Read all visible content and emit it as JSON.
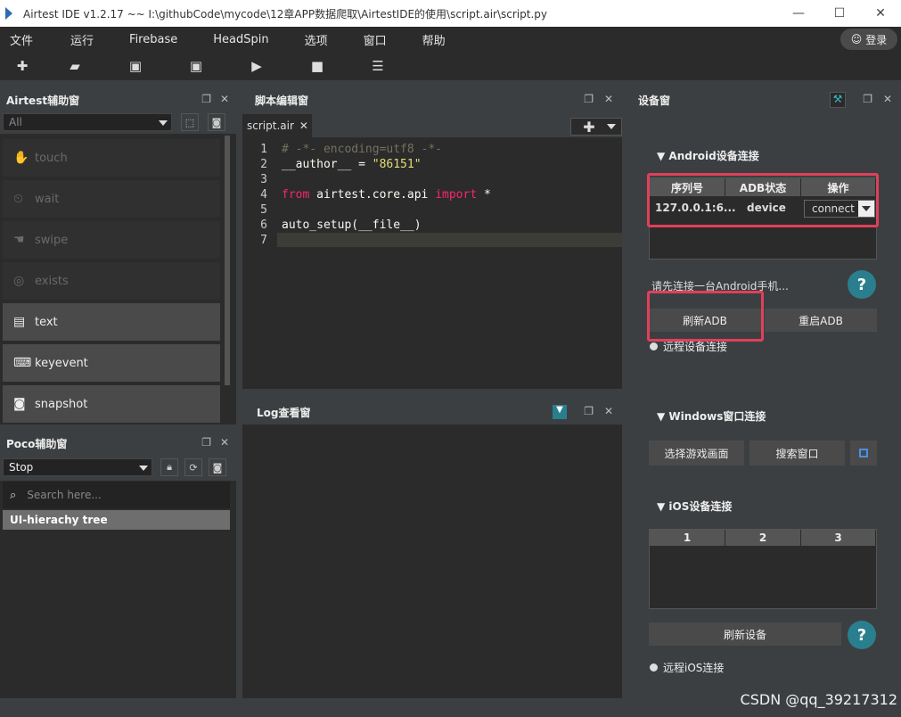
{
  "window": {
    "title": "Airtest IDE v1.2.17 ~~ I:\\githubCode\\mycode\\12章APP数据爬取\\AirtestIDE的使用\\script.air\\script.py",
    "minimize": "—",
    "maximize": "☐",
    "close": "✕"
  },
  "menu": {
    "items": [
      "文件",
      "运行",
      "Firebase",
      "HeadSpin",
      "选项",
      "窗口",
      "帮助"
    ],
    "login": "登录"
  },
  "toolbar": {
    "icons": [
      "new-icon",
      "open-icon",
      "save-icon",
      "save-as-icon",
      "run-icon",
      "stop-icon",
      "log-icon"
    ],
    "glyphs": [
      "✚",
      "▰",
      "▣",
      "▣",
      "▶",
      "■",
      "☰"
    ]
  },
  "airtest_panel": {
    "title": "Airtest辅助窗",
    "filter_value": "All",
    "buttons": [
      {
        "label": "touch",
        "icon": "✋"
      },
      {
        "label": "wait",
        "icon": "⏲"
      },
      {
        "label": "swipe",
        "icon": "☚"
      },
      {
        "label": "exists",
        "icon": "◎"
      },
      {
        "label": "text",
        "icon": "▤"
      },
      {
        "label": "keyevent",
        "icon": "⌨"
      },
      {
        "label": "snapshot",
        "icon": "◙"
      }
    ]
  },
  "poco_panel": {
    "title": "Poco辅助窗",
    "mode_value": "Stop",
    "search_placeholder": "Search here...",
    "tree_item": "UI-hierachy tree"
  },
  "script_panel": {
    "title": "脚本编辑窗",
    "tab_label": "script.air",
    "tab_close": "✕",
    "lines": [
      {
        "n": "1",
        "text": "# -*- encoding=utf8 -*-"
      },
      {
        "n": "2",
        "text": "__author__ = \"86151\""
      },
      {
        "n": "3",
        "text": ""
      },
      {
        "n": "4",
        "text": "from airtest.core.api import *"
      },
      {
        "n": "5",
        "text": ""
      },
      {
        "n": "6",
        "text": "auto_setup(__file__)"
      },
      {
        "n": "7",
        "text": ""
      }
    ],
    "add": "✚"
  },
  "log_panel": {
    "title": "Log查看窗"
  },
  "device_panel": {
    "title": "设备窗",
    "android": {
      "title": "▼ Android设备连接",
      "headers": [
        "序列号",
        "ADB状态",
        "操作"
      ],
      "row": {
        "serial": "127.0.0.1:6...",
        "status": "device",
        "action": "connect"
      },
      "hint": "请先连接一台Android手机...",
      "refresh": "刷新ADB",
      "restart": "重启ADB",
      "remote": "远程设备连接"
    },
    "windows": {
      "title": "▼ Windows窗口连接",
      "select": "选择游戏画面",
      "search": "搜索窗口"
    },
    "ios": {
      "title": "▼ iOS设备连接",
      "headers": [
        "1",
        "2",
        "3"
      ],
      "refresh": "刷新设备",
      "remote": "远程iOS连接"
    },
    "help": "?"
  },
  "watermark": "CSDN @qq_39217312"
}
